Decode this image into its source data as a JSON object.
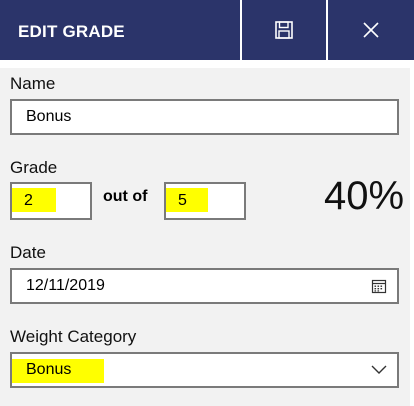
{
  "header": {
    "title": "EDIT GRADE",
    "save_icon": "save-icon",
    "close_icon": "close-icon"
  },
  "colors": {
    "header_bg": "#2b346a",
    "highlight": "#ffff00"
  },
  "form": {
    "name_label": "Name",
    "name_value": "Bonus",
    "grade_label": "Grade",
    "grade_value": "2",
    "out_of_label": "out of",
    "out_of_value": "5",
    "percent": "40%",
    "date_label": "Date",
    "date_value": "12/11/2019",
    "calendar_icon": "calendar-icon",
    "weight_label": "Weight Category",
    "weight_value": "Bonus",
    "dropdown_icon": "chevron-down-icon"
  }
}
